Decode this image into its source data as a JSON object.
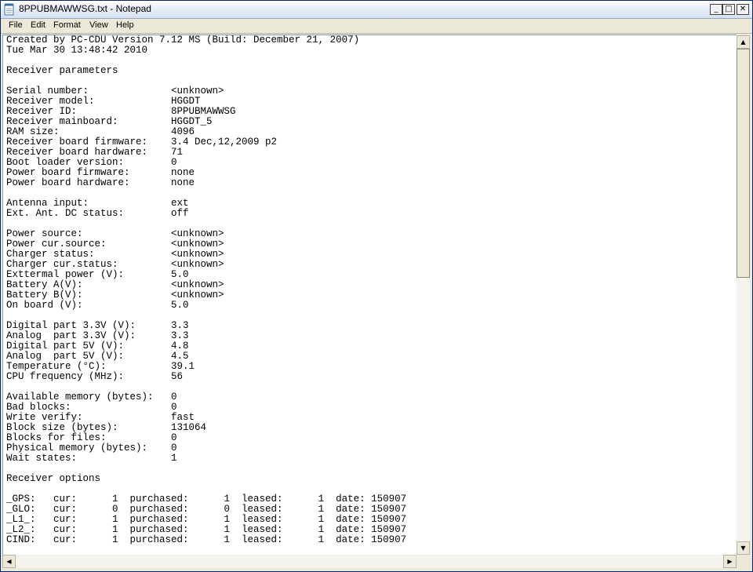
{
  "window": {
    "title": "8PPUBMAWWSG.txt - Notepad"
  },
  "icons": {
    "app": "notepad-icon",
    "minimize": "minimize-icon",
    "maximize": "maximize-icon",
    "close": "close-icon"
  },
  "menu": {
    "file": "File",
    "edit": "Edit",
    "format": "Format",
    "view": "View",
    "help": "Help"
  },
  "document": {
    "lines": [
      "Created by PC-CDU Version 7.12 MS (Build: December 21, 2007)",
      "Tue Mar 30 13:48:42 2010",
      "",
      "Receiver parameters",
      "",
      "Serial number:              <unknown>",
      "Receiver model:             HGGDT",
      "Receiver ID:                8PPUBMAWWSG",
      "Receiver mainboard:         HGGDT_5",
      "RAM size:                   4096",
      "Receiver board firmware:    3.4 Dec,12,2009 p2",
      "Receiver board hardware:    71",
      "Boot loader version:        0",
      "Power board firmware:       none",
      "Power board hardware:       none",
      "",
      "Antenna input:              ext",
      "Ext. Ant. DC status:        off",
      "",
      "Power source:               <unknown>",
      "Power cur.source:           <unknown>",
      "Charger status:             <unknown>",
      "Charger cur.status:         <unknown>",
      "Exttermal power (V):        5.0",
      "Battery A(V):               <unknown>",
      "Battery B(V):               <unknown>",
      "On board (V):               5.0",
      "",
      "Digital part 3.3V (V):      3.3",
      "Analog  part 3.3V (V):      3.3",
      "Digital part 5V (V):        4.8",
      "Analog  part 5V (V):        4.5",
      "Temperature (°C):           39.1",
      "CPU frequency (MHz):        56",
      "",
      "Available memory (bytes):   0",
      "Bad blocks:                 0",
      "Write verify:               fast",
      "Block size (bytes):         131064",
      "Blocks for files:           0",
      "Physical memory (bytes):    0",
      "Wait states:                1",
      "",
      "Receiver options",
      "",
      "_GPS:   cur:      1  purchased:      1  leased:      1  date: 150907",
      "_GLO:   cur:      0  purchased:      0  leased:      1  date: 150907",
      "_L1_:   cur:      1  purchased:      1  leased:      1  date: 150907",
      "_L2_:   cur:      1  purchased:      1  leased:      1  date: 150907",
      "CIND:   cur:      1  purchased:      1  leased:      1  date: 150907"
    ]
  }
}
